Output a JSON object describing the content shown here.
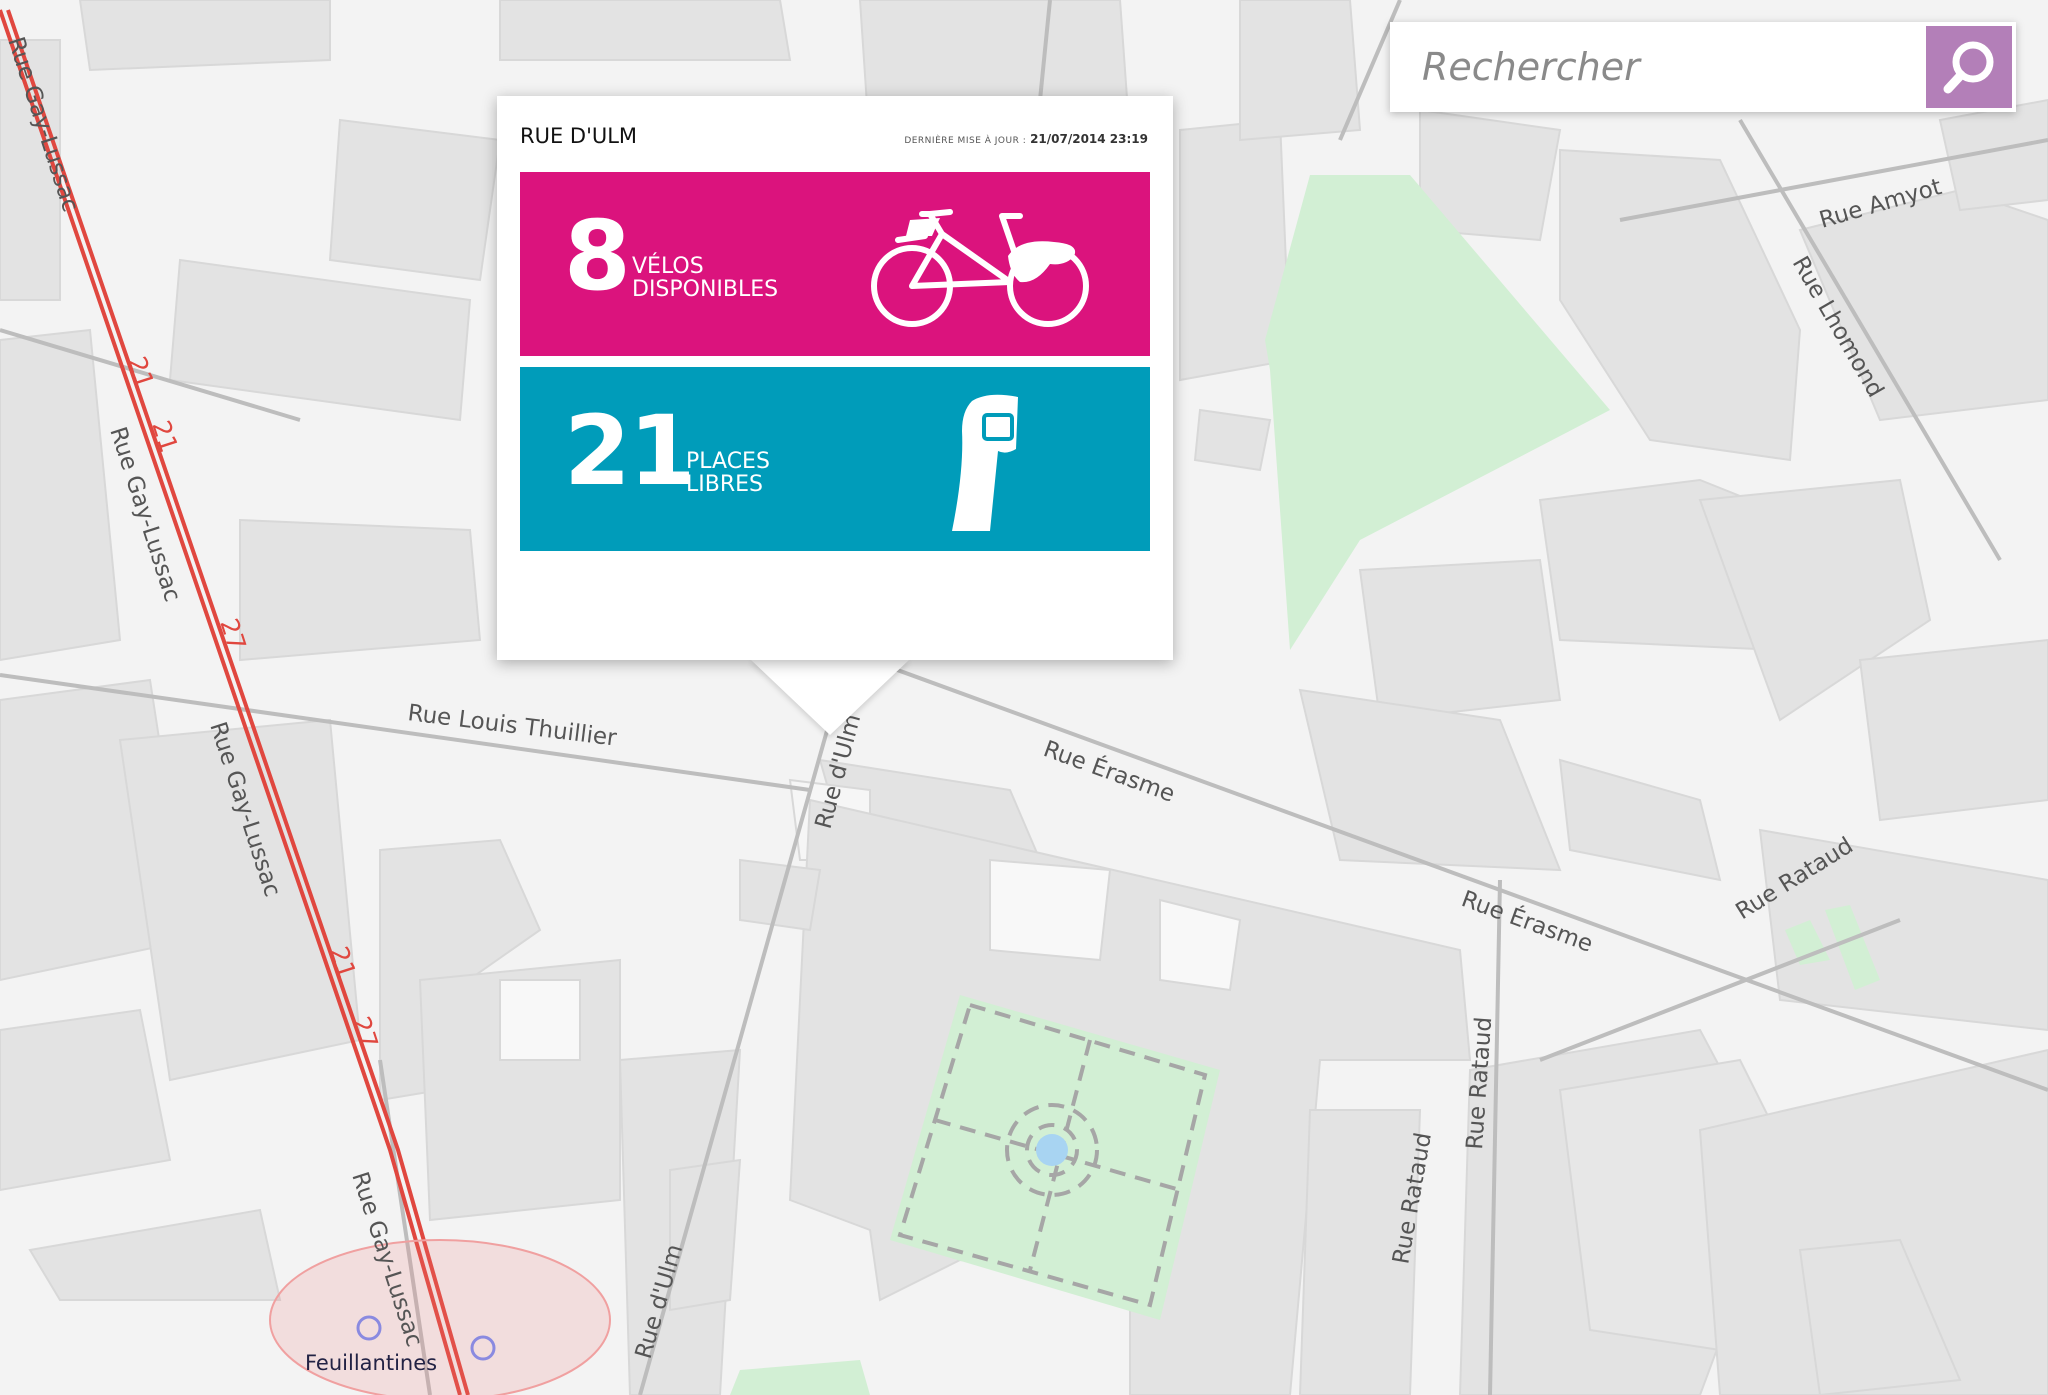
{
  "search": {
    "placeholder": "Rechercher"
  },
  "station": {
    "name": "RUE D'ULM",
    "update_label": "DERNIÈRE MISE À JOUR :",
    "update_value": "21/07/2014 23:19",
    "bikes": {
      "count": "8",
      "label_line1": "VÉLOS",
      "label_line2": "DISPONIBLES",
      "color": "#db137d"
    },
    "docks": {
      "count": "21",
      "label_line1": "PLACES",
      "label_line2": "LIBRES",
      "color": "#009cba"
    }
  },
  "map": {
    "streets": {
      "gay_lussac_1": "Rue Gay-Lussac",
      "gay_lussac_2": "Rue Gay-Lussac",
      "gay_lussac_3": "Rue Gay-Lussac",
      "gay_lussac_4": "Rue Gay-Lussac",
      "louis_thuillier": "Rue Louis Thuillier",
      "ulm_1": "Rue d'Ulm",
      "ulm_2": "Rue d'Ulm",
      "erasme_1": "Rue Érasme",
      "erasme_2": "Rue Érasme",
      "amyot": "Rue Amyot",
      "lhomond": "Rue Lhomond",
      "rataud_1": "Rue Rataud",
      "rataud_2": "Rue Rataud",
      "rataud_3": "Rue Rataud"
    },
    "bus_labels": {
      "b1": "21",
      "b2": "21",
      "b3": "27",
      "b4": "21",
      "b5": "27"
    },
    "stop_name": "Feuillantines",
    "colors": {
      "bus_line": "#e0473f",
      "park": "#d2efd4",
      "building": "#e4e4e4"
    }
  }
}
